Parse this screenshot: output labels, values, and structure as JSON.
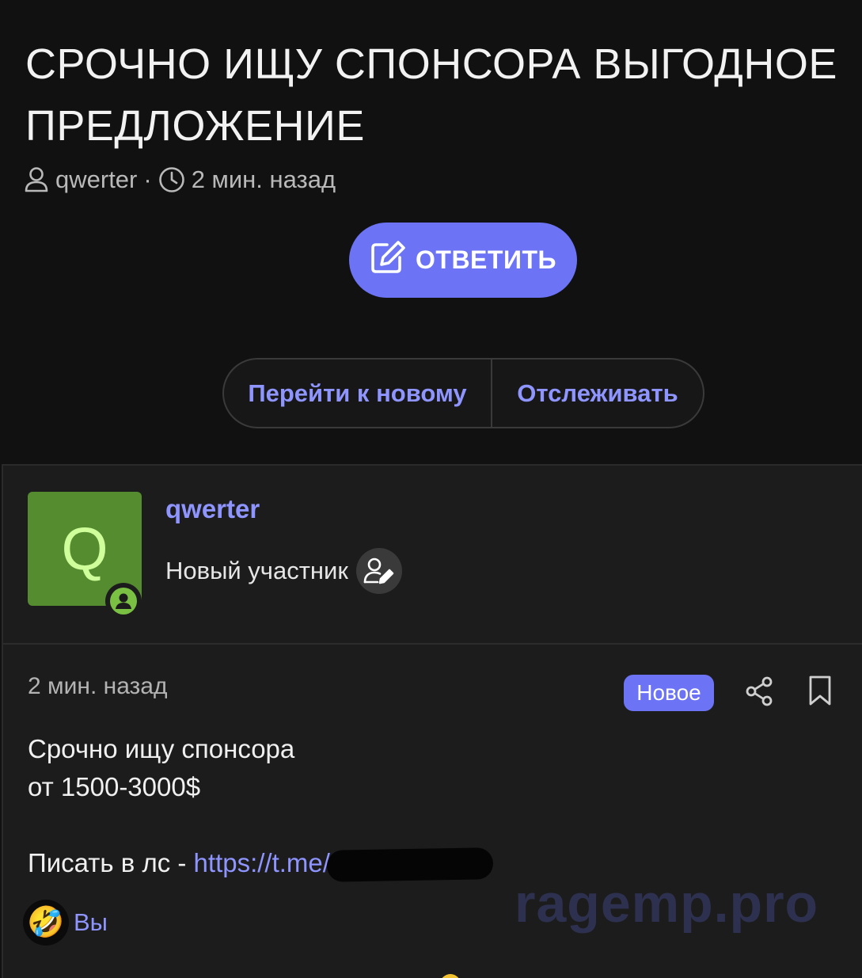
{
  "thread": {
    "title": "СРОЧНО ИЩУ СПОНСОРА ВЫГОДНОЕ ПРЕДЛОЖЕНИЕ",
    "author": "qwerter",
    "separator": "·",
    "time": "2 мин. назад"
  },
  "actions": {
    "reply_label": "ОТВЕТИТЬ",
    "goto_new_label": "Перейти к новому",
    "follow_label": "Отслеживать"
  },
  "post": {
    "avatar_letter": "Q",
    "author_name": "qwerter",
    "author_role": "Новый участник",
    "time": "2 мин. назад",
    "badge": "Новое",
    "body": {
      "line1": "Срочно ищу спонсора",
      "line2": "от 1500-3000$",
      "line3_prefix": "Писать в лс - ",
      "link": "https://t.me/"
    },
    "reaction": {
      "emoji": "🤣",
      "label": "Вы"
    }
  },
  "watermark": "ragemp.pro",
  "colors": {
    "accent": "#6c74f5",
    "link": "#8f95ff",
    "avatar_bg": "#548c2f",
    "online": "#7ac143"
  }
}
